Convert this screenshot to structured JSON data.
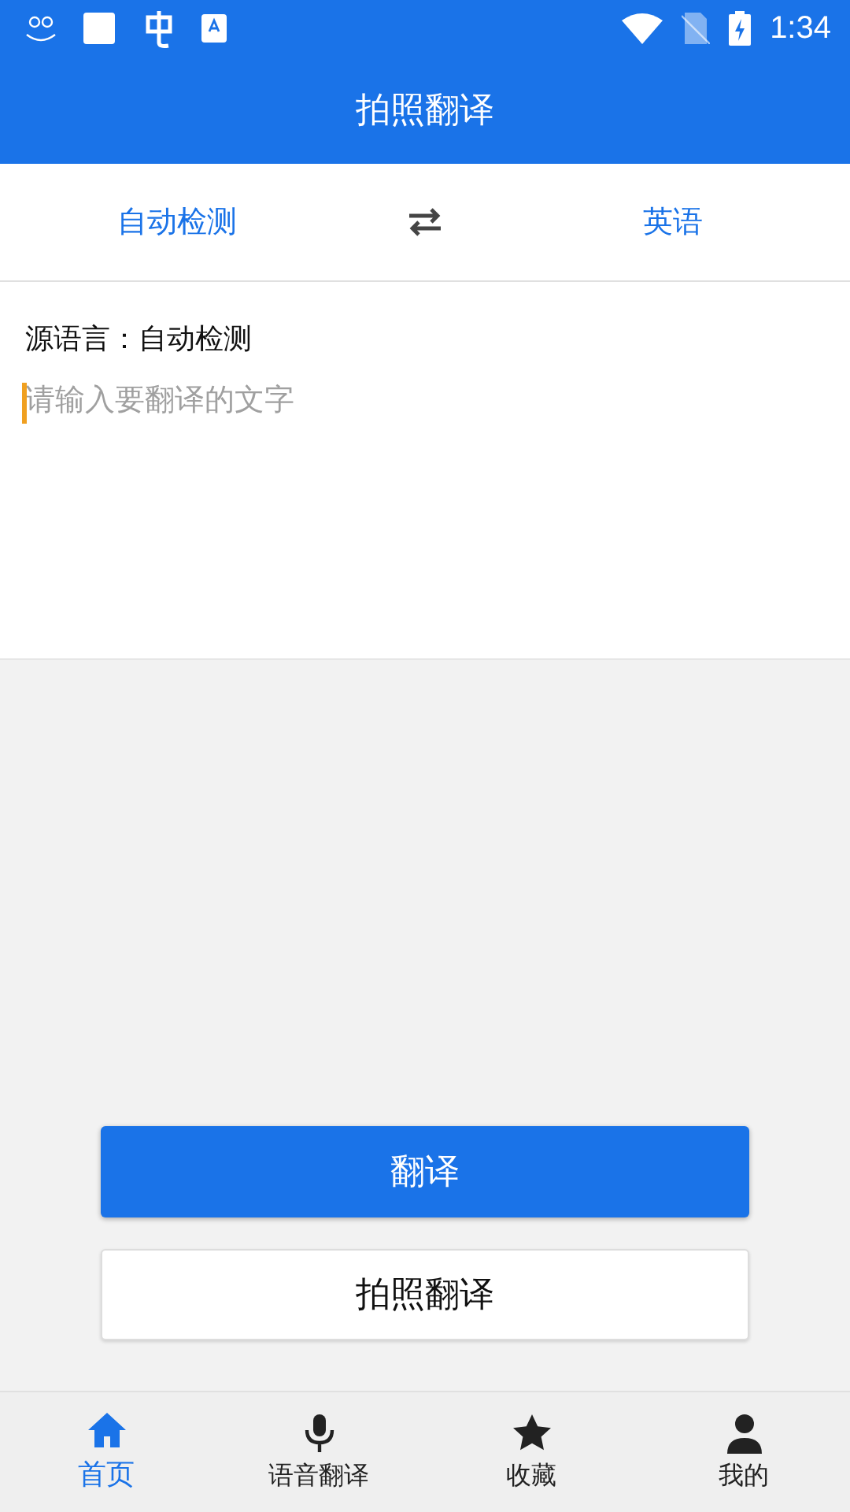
{
  "status_bar": {
    "time": "1:34"
  },
  "header": {
    "title": "拍照翻译"
  },
  "language_bar": {
    "source": "自动检测",
    "target": "英语"
  },
  "input": {
    "source_label": "源语言：自动检测",
    "placeholder": "请输入要翻译的文字",
    "focused": true
  },
  "buttons": [
    {
      "label": "翻译",
      "kind": "primary"
    },
    {
      "label": "拍照翻译",
      "kind": "secondary"
    }
  ],
  "bottom_nav": [
    {
      "label": "首页",
      "kind": "home",
      "selected": true
    },
    {
      "label": "语音翻译",
      "kind": "voice",
      "selected": false
    },
    {
      "label": "收藏",
      "kind": "favorites",
      "selected": false
    },
    {
      "label": "我的",
      "kind": "profile",
      "selected": false
    }
  ]
}
